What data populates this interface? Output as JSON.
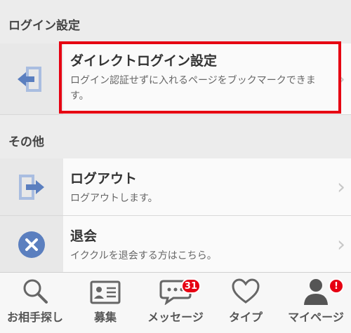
{
  "sections": {
    "login_settings": {
      "header": "ログイン設定",
      "item": {
        "title": "ダイレクトログイン設定",
        "desc": "ログイン認証せずに入れるページをブックマークできます。"
      }
    },
    "other": {
      "header": "その他",
      "logout": {
        "title": "ログアウト",
        "desc": "ログアウトします。"
      },
      "withdraw": {
        "title": "退会",
        "desc": "イククルを退会する方はこちら。"
      }
    }
  },
  "chevron": "›",
  "tabbar": {
    "tabs": [
      {
        "label": "お相手探し",
        "icon": "search-icon"
      },
      {
        "label": "募集",
        "icon": "id-card-icon"
      },
      {
        "label": "メッセージ",
        "icon": "chat-bubble-icon",
        "badge": "31"
      },
      {
        "label": "タイプ",
        "icon": "heart-icon"
      },
      {
        "label": "マイページ",
        "icon": "person-icon",
        "badge": "!"
      }
    ]
  },
  "colors": {
    "accent_red": "#e60012",
    "icon_blue": "#5b7fbf",
    "icon_blue_light": "#a9bde0"
  }
}
